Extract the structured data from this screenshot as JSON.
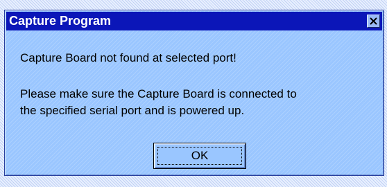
{
  "window": {
    "title": "Capture Program",
    "close_icon": "close-icon"
  },
  "message": {
    "line1": "Capture Board not found at selected port!",
    "line2": "Please make sure the Capture Board is connected to",
    "line3": "the specified serial port and is powered up."
  },
  "buttons": {
    "ok_label": "OK"
  },
  "colors": {
    "title_bar": "#0b16b8",
    "dialog_bg": "#9ac6ff",
    "title_text": "#ffffff"
  }
}
